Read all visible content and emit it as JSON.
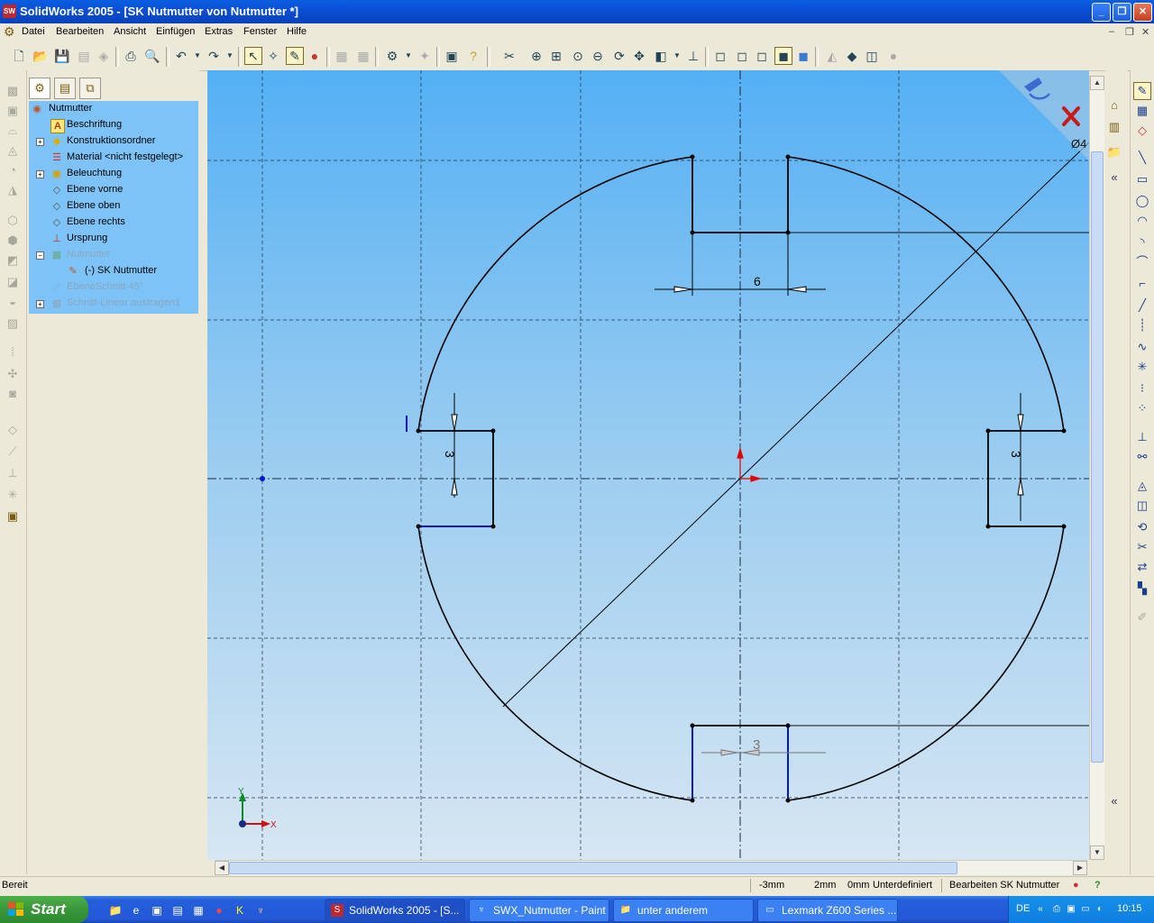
{
  "window": {
    "title": "SolidWorks 2005 - [SK Nutmutter von Nutmutter *]",
    "app_icon": "sw-logo-icon",
    "controls": [
      "minimize-icon",
      "maximize-icon",
      "close-icon"
    ]
  },
  "menu": [
    "Datei",
    "Bearbeiten",
    "Ansicht",
    "Einfügen",
    "Extras",
    "Fenster",
    "Hilfe"
  ],
  "feature_tree": {
    "tabs": [
      "feature-manager-tab",
      "property-manager-tab",
      "configuration-manager-tab"
    ],
    "items": [
      {
        "label": "Nutmutter",
        "icon": "part-icon",
        "expander": ""
      },
      {
        "label": "Beschriftung",
        "icon": "annotation-icon",
        "expander": ""
      },
      {
        "label": "Konstruktionsordner",
        "icon": "design-binder-icon",
        "expander": "+"
      },
      {
        "label": "Material <nicht festgelegt>",
        "icon": "material-icon",
        "expander": ""
      },
      {
        "label": "Beleuchtung",
        "icon": "lighting-icon",
        "expander": "+"
      },
      {
        "label": "Ebene vorne",
        "icon": "plane-icon",
        "expander": ""
      },
      {
        "label": "Ebene oben",
        "icon": "plane-icon",
        "expander": ""
      },
      {
        "label": "Ebene rechts",
        "icon": "plane-icon",
        "expander": ""
      },
      {
        "label": "Ursprung",
        "icon": "origin-icon",
        "expander": ""
      },
      {
        "label": "Nutmutter",
        "icon": "feature-icon",
        "expander": "−"
      },
      {
        "label": "(-) SK Nutmutter",
        "icon": "sketch-icon",
        "expander": ""
      },
      {
        "label": "EbeneSchnitt 45°",
        "icon": "plane-icon",
        "expander": ""
      },
      {
        "label": "Schnitt-Linear austragen1",
        "icon": "cut-extrude-icon",
        "expander": "+"
      }
    ]
  },
  "sketch": {
    "dimensions": {
      "top_slot_width": "6",
      "bottom_slot_width": "3",
      "left_slot_width": "3",
      "right_slot_width": "3"
    },
    "axis_labels": {
      "x": "X",
      "y": "Y"
    },
    "diameter_label": "Ø4"
  },
  "status": {
    "left": "Bereit",
    "x": "-3mm",
    "y": "2mm",
    "z": "0mm",
    "state": "Unterdefiniert",
    "mode": "Bearbeiten SK Nutmutter"
  },
  "taskbar": {
    "start": "Start",
    "tasks": [
      {
        "label": "SolidWorks 2005 - [S...",
        "icon": "sw-task-icon",
        "active": true
      },
      {
        "label": "SWX_Nutmutter - Paint",
        "icon": "paint-icon",
        "active": false
      },
      {
        "label": "unter anderem",
        "icon": "folder-icon",
        "active": false
      },
      {
        "label": "Lexmark Z600 Series ...",
        "icon": "printer-icon",
        "active": false
      }
    ],
    "lang": "DE",
    "clock": "10:15"
  },
  "colors": {
    "titlebar": "#0b4fd8",
    "tree_bg": "#7ec3f7",
    "sketch_line": "#000000",
    "selected_line": "#0018c8",
    "origin": "#e00000"
  }
}
